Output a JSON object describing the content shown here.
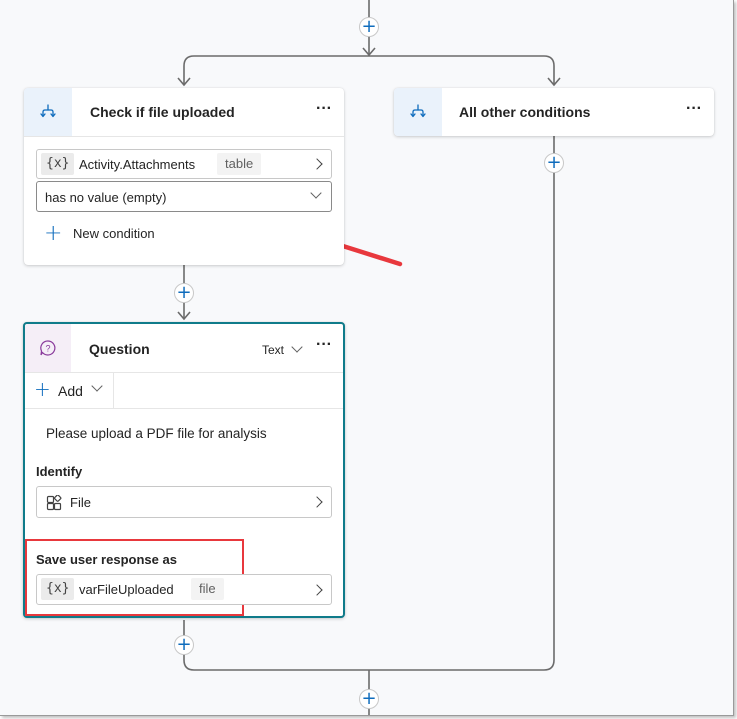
{
  "check_card": {
    "title": "Check if file uploaded",
    "menu": "···",
    "variable_icon": "{x}",
    "variable": "Activity.Attachments",
    "variable_type": "table",
    "operator": "has no value (empty)",
    "new_condition": "New condition",
    "icon": "branch-icon"
  },
  "other_card": {
    "title": "All other conditions",
    "menu": "···",
    "icon": "branch-icon"
  },
  "question_card": {
    "title": "Question",
    "type_select": "Text",
    "menu": "···",
    "add_label": "Add",
    "prompt": "Please upload a PDF file for analysis",
    "identify_label": "Identify",
    "identify_value": "File",
    "save_label": "Save user response as",
    "variable_icon": "{x}",
    "save_variable": "varFileUploaded",
    "save_type": "file",
    "icon": "question-bubble-icon"
  },
  "add_glyph": "+",
  "colors": {
    "accent": "#0f6cbd",
    "selected_border": "#0f7b8a",
    "annotation_red": "#e8383d",
    "connector": "#616161"
  }
}
